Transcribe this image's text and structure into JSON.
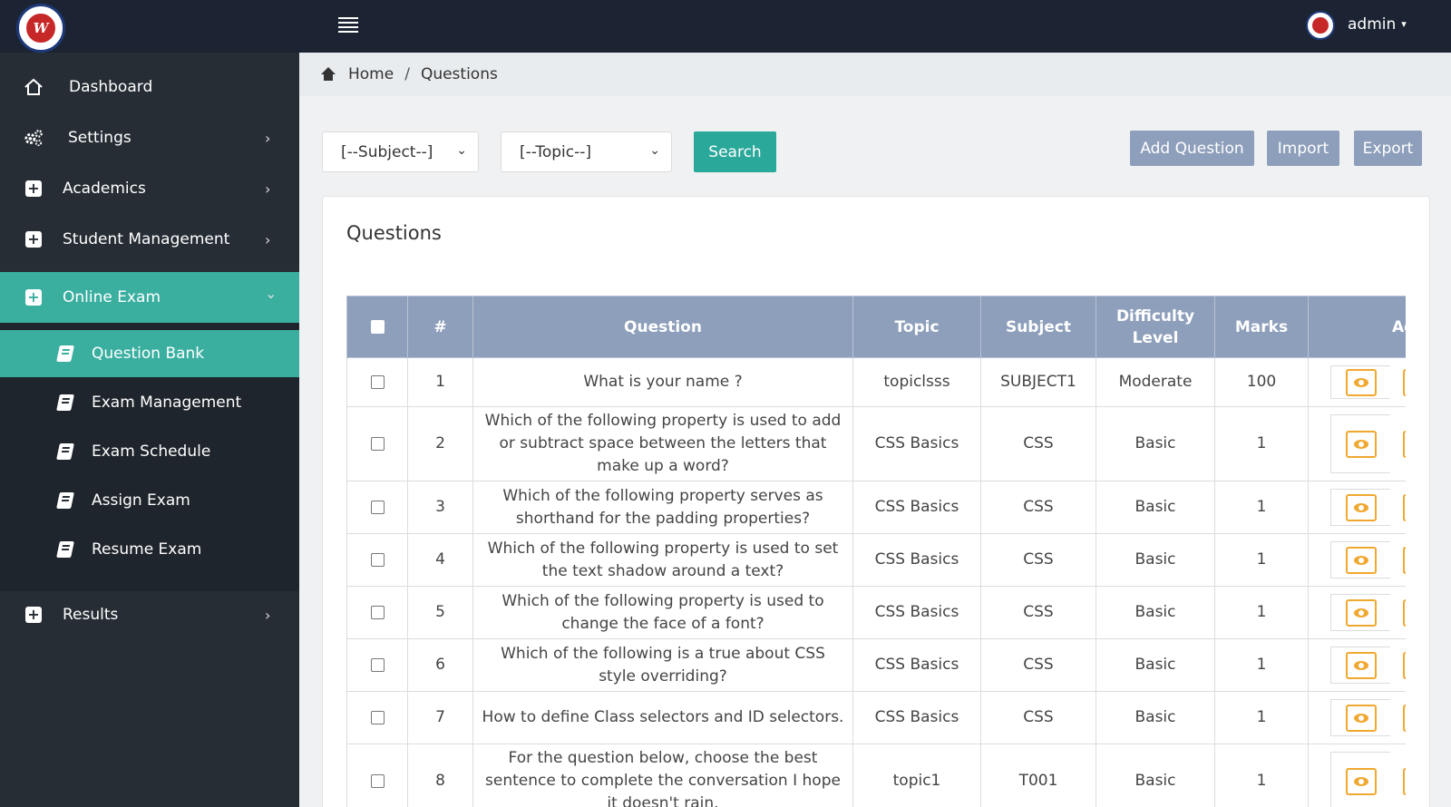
{
  "topbar": {
    "user_name": "admin",
    "caret": "▾"
  },
  "sidebar": {
    "items": [
      {
        "label": "Dashboard",
        "icon": "home-icon"
      },
      {
        "label": "Settings",
        "icon": "gears-icon"
      },
      {
        "label": "Academics",
        "icon": "plus-square-icon"
      },
      {
        "label": "Student Management",
        "icon": "plus-square-icon"
      },
      {
        "label": "Online Exam",
        "icon": "plus-square-icon",
        "active": true
      },
      {
        "label": "Results",
        "icon": "plus-square-icon"
      }
    ],
    "submenu": [
      {
        "label": "Question Bank",
        "active": true
      },
      {
        "label": "Exam Management"
      },
      {
        "label": "Exam Schedule"
      },
      {
        "label": "Assign Exam"
      },
      {
        "label": "Resume Exam"
      }
    ],
    "chevron_right": "›",
    "chevron_down": "⌄"
  },
  "breadcrumb": {
    "home": "Home",
    "separator": "/",
    "current": "Questions"
  },
  "filters": {
    "subject": "[--Subject--]",
    "topic": "[--Topic--]",
    "search_label": "Search"
  },
  "actions": {
    "add_question": "Add Question",
    "import": "Import",
    "export": "Export"
  },
  "card": {
    "title": "Questions"
  },
  "table": {
    "headers": [
      "#",
      "Question",
      "Topic",
      "Subject",
      "Difficulty Level",
      "Marks",
      "Ac"
    ],
    "rows": [
      {
        "num": "1",
        "question": "What is your name ?",
        "topic": "topiclsss",
        "subject": "SUBJECT1",
        "difficulty": "Moderate",
        "marks": "100"
      },
      {
        "num": "2",
        "question": "Which of the following property is used to add or subtract space between the letters that make up a word?",
        "topic": "CSS Basics",
        "subject": "CSS",
        "difficulty": "Basic",
        "marks": "1"
      },
      {
        "num": "3",
        "question": "Which of the following property serves as shorthand for the padding properties?",
        "topic": "CSS Basics",
        "subject": "CSS",
        "difficulty": "Basic",
        "marks": "1"
      },
      {
        "num": "4",
        "question": "Which of the following property is used to set the text shadow around a text?",
        "topic": "CSS Basics",
        "subject": "CSS",
        "difficulty": "Basic",
        "marks": "1"
      },
      {
        "num": "5",
        "question": "Which of the following property is used to change the face of a font?",
        "topic": "CSS Basics",
        "subject": "CSS",
        "difficulty": "Basic",
        "marks": "1"
      },
      {
        "num": "6",
        "question": "Which of the following is a true about CSS style overriding?",
        "topic": "CSS Basics",
        "subject": "CSS",
        "difficulty": "Basic",
        "marks": "1"
      },
      {
        "num": "7",
        "question": "How to define Class selectors and ID selectors.",
        "topic": "CSS Basics",
        "subject": "CSS",
        "difficulty": "Basic",
        "marks": "1"
      },
      {
        "num": "8",
        "question": "For the question below, choose the best sentence to complete the conversation I hope it doesn't rain.",
        "topic": "topic1",
        "subject": "T001",
        "difficulty": "Basic",
        "marks": "1"
      }
    ]
  },
  "colors": {
    "topbar": "#1c2434",
    "sidebar": "#262d35",
    "accent": "#3aafa0",
    "table_header": "#8e9fbb",
    "view_button": "#f0a830"
  }
}
